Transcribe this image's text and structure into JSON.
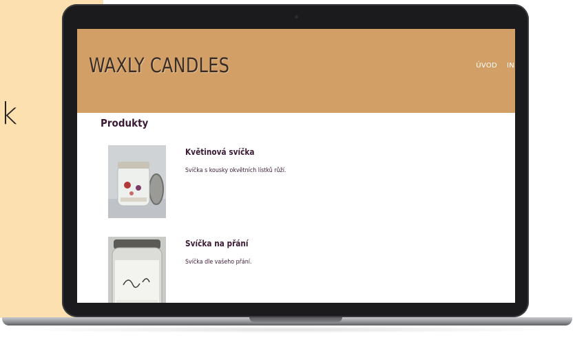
{
  "background": {
    "fragment_text": "k",
    "panel_color": "#fce0b0"
  },
  "site": {
    "title": "WAXLY CANDLES",
    "header_color": "#d2a067",
    "nav": [
      {
        "label": "ÚVOD"
      },
      {
        "label": "IN"
      }
    ]
  },
  "main": {
    "section_title": "Produkty",
    "products": [
      {
        "name": "Květinová svíčka",
        "description": "Svíčka s kousky okvětních lístků růží.",
        "image_icon": "candle-jar-photo"
      },
      {
        "name": "Svíčka na přání",
        "description": "Svíčka dle vašeho přání.",
        "image_icon": "candle-jar-photo"
      }
    ]
  },
  "colors": {
    "text_dark": "#3b1a33",
    "laptop_frame": "#1b1b1d"
  }
}
